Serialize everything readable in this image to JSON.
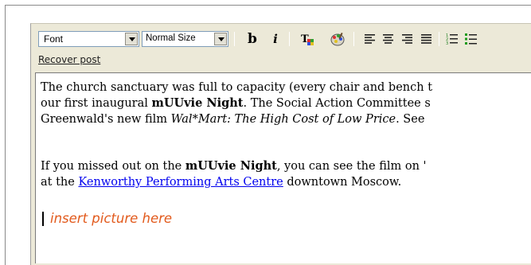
{
  "toolbar": {
    "font_select": "Font",
    "size_select": "Normal Size",
    "bold_label": "b",
    "italic_label": "i"
  },
  "links": {
    "recover_post": "Recover post"
  },
  "content": {
    "p1_l1": "The church sanctuary was full to capacity (every chair and bench t",
    "p1_l2_a": "our first inaugural ",
    "p1_l2_b": "mUUvie Night",
    "p1_l2_c": ". The Social Action Committee s",
    "p1_l3_a": "Greenwald's new film ",
    "p1_l3_b": "Wal*Mart: The High Cost of Low Price",
    "p1_l3_c": ". See",
    "p2_l1_a": "If you missed out on the ",
    "p2_l1_b": "mUUvie Night",
    "p2_l1_c": ", you can see the film on '",
    "p2_l2_a": "at the ",
    "p2_l2_link": "Kenworthy Performing Arts Centre",
    "p2_l2_c": " downtown Moscow.",
    "placeholder": "insert picture here"
  },
  "colors": {
    "placeholder": "#e25a1c",
    "link": "#0000ee",
    "toolbar_bg": "#ece9d8"
  },
  "icons": [
    "dropdown-arrow-icon",
    "text-color-icon",
    "highlight-color-icon",
    "align-left-icon",
    "align-center-icon",
    "align-right-icon",
    "justify-icon",
    "ordered-list-icon",
    "unordered-list-icon"
  ]
}
